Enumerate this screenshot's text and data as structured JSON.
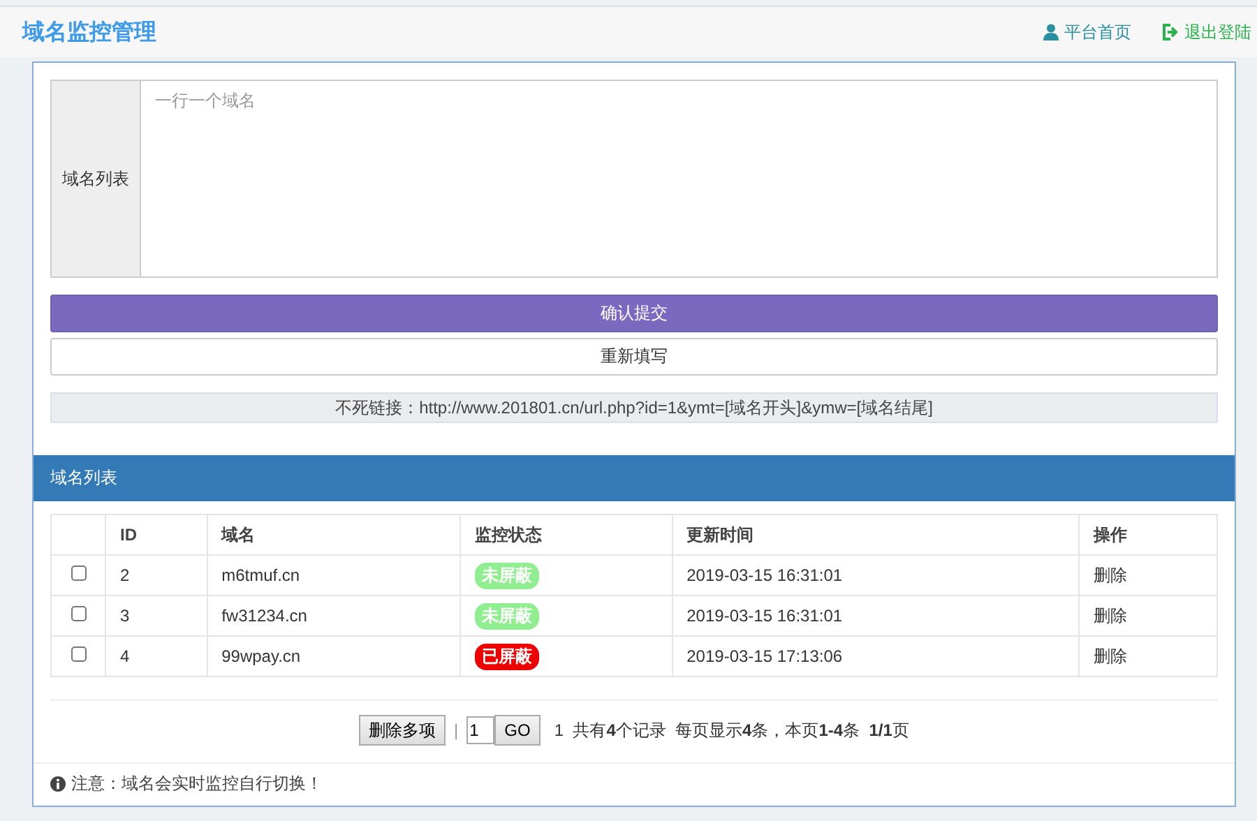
{
  "header": {
    "title": "域名监控管理",
    "links": [
      {
        "label": "平台首页",
        "kind": "user"
      },
      {
        "label": "退出登陆",
        "kind": "logout"
      }
    ]
  },
  "form": {
    "label": "域名列表",
    "placeholder": "一行一个域名",
    "submit": "确认提交",
    "reset": "重新填写",
    "link_info": "不死链接：http://www.201801.cn/url.php?id=1&ymt=[域名开头]&ymw=[域名结尾]"
  },
  "table": {
    "title": "域名列表",
    "columns": [
      "ID",
      "域名",
      "监控状态",
      "更新时间",
      "操作"
    ],
    "rows": [
      {
        "checked": false,
        "id": "2",
        "domain": "m6tmuf.cn",
        "status": "未屏蔽",
        "blocked": false,
        "time": "2019-03-15 16:31:01",
        "action": "删除"
      },
      {
        "checked": false,
        "id": "3",
        "domain": "fw31234.cn",
        "status": "未屏蔽",
        "blocked": false,
        "time": "2019-03-15 16:31:01",
        "action": "删除"
      },
      {
        "checked": false,
        "id": "4",
        "domain": "99wpay.cn",
        "status": "已屏蔽",
        "blocked": true,
        "time": "2019-03-15 17:13:06",
        "action": "删除"
      }
    ]
  },
  "pager": {
    "delete_button": "删除多项",
    "separator": "|",
    "page_value": "1",
    "go_button": "GO",
    "summary": "1  共有**4**个记录  每页显示**4**条，本页**1-4**条  **1/1**页"
  },
  "note": "注意：域名会实时监控自行切换！"
}
